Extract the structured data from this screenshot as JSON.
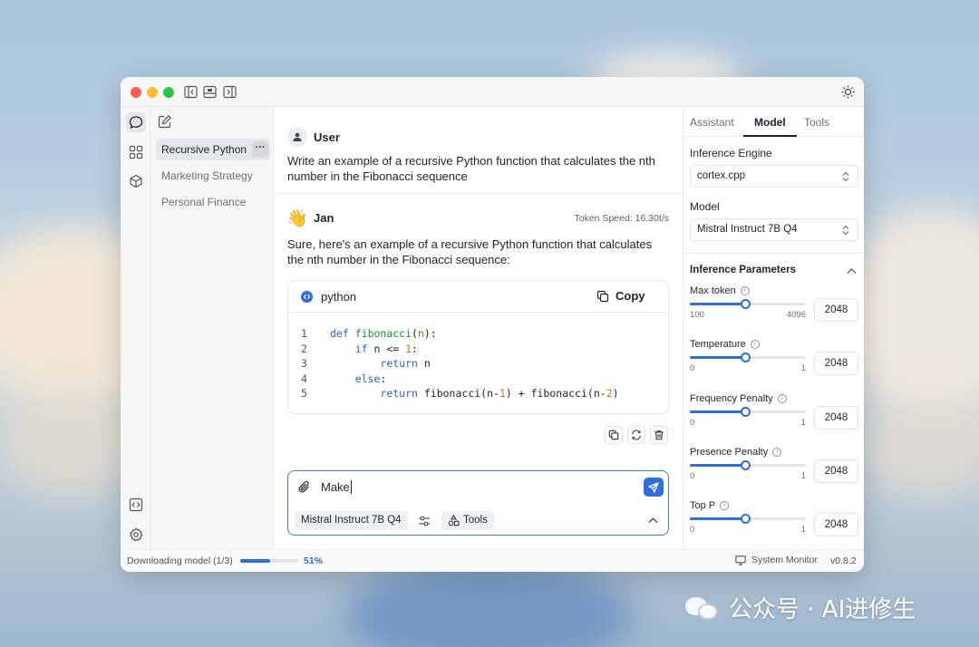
{
  "app": {
    "threads": [
      {
        "label": "Recursive Python"
      },
      {
        "label": "Marketing Strategy"
      },
      {
        "label": "Personal Finance"
      }
    ]
  },
  "chat": {
    "user": {
      "name": "User",
      "text": "Write an example of a recursive Python function that calculates the nth number in the Fibonacci sequence"
    },
    "assistant": {
      "emoji": "👋",
      "name": "Jan",
      "token_speed": "Token Speed: 16.30t/s",
      "text": "Sure, here's an example of a recursive Python function that calculates the nth number in the Fibonacci sequence:",
      "code": {
        "language": "python",
        "copy_label": "Copy",
        "line_numbers": [
          "1",
          "2",
          "3",
          "4",
          "5"
        ]
      }
    },
    "composer": {
      "value": "Make",
      "model_chip": "Mistral Instruct 7B Q4",
      "tools_label": "Tools"
    }
  },
  "side_panel": {
    "tabs": [
      {
        "label": "Assistant"
      },
      {
        "label": "Model"
      },
      {
        "label": "Tools"
      }
    ],
    "active_tab": "Model",
    "engine_label": "Inference Engine",
    "engine_value": "cortex.cpp",
    "model_label": "Model",
    "model_value": "Mistral Instruct 7B Q4",
    "params_title": "Inference Parameters",
    "params": [
      {
        "label": "Max token",
        "min": "100",
        "max": "4096",
        "value": "2048",
        "slider_fraction": 0.48
      },
      {
        "label": "Temperature",
        "min": "0",
        "max": "1",
        "value": "2048",
        "slider_fraction": 0.48
      },
      {
        "label": "Frequency Penalty",
        "min": "0",
        "max": "1",
        "value": "2048",
        "slider_fraction": 0.48
      },
      {
        "label": "Presence Penalty",
        "min": "0",
        "max": "1",
        "value": "2048",
        "slider_fraction": 0.48
      },
      {
        "label": "Top P",
        "min": "0",
        "max": "1",
        "value": "2048",
        "slider_fraction": 0.48
      }
    ]
  },
  "status": {
    "downloading": "Downloading model (1/3)",
    "progress_percent": "51%",
    "progress_fraction": 0.51,
    "system_monitor": "System Monitor",
    "version": "v0.8.2"
  },
  "watermark": {
    "text": "公众号 · AI进修生"
  },
  "colors": {
    "accent": "#2f6de1",
    "traffic_red": "#fe5f57",
    "traffic_yellow": "#febc2e",
    "traffic_green": "#28c840"
  }
}
